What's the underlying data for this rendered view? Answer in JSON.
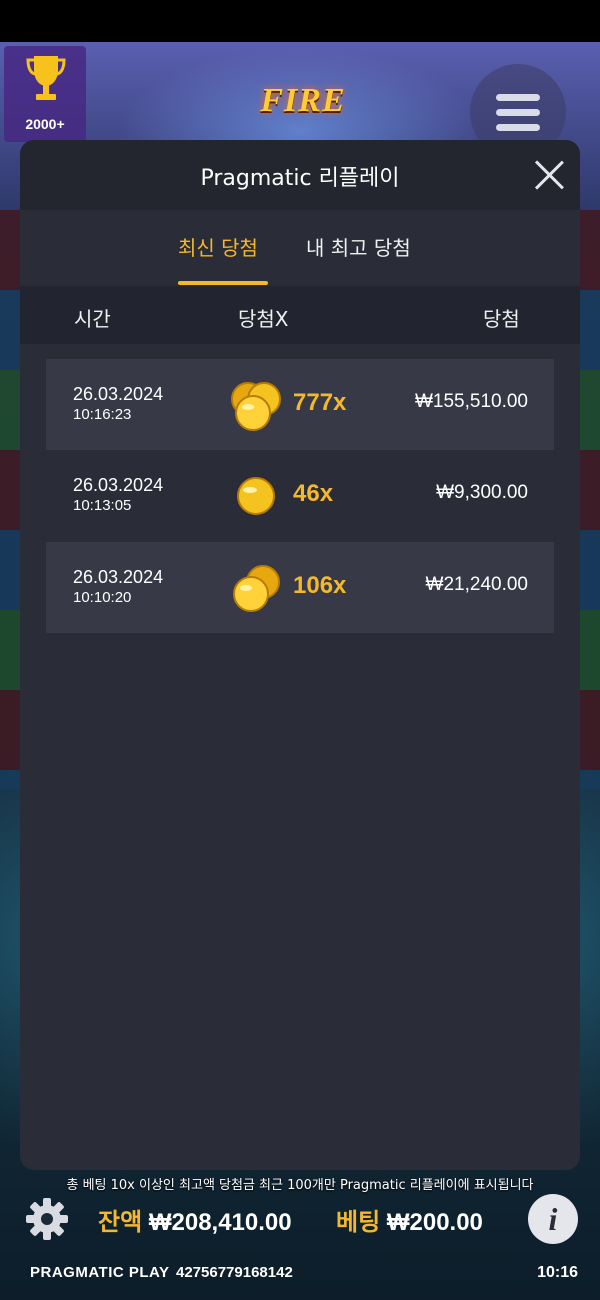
{
  "game": {
    "trophy_count": "2000+",
    "logo_text": "FIRE",
    "menu_icon": "hamburger-menu-icon"
  },
  "modal": {
    "title": "Pragmatic 리플레이",
    "tabs": [
      {
        "label": "최신 당첨",
        "active": true
      },
      {
        "label": "내 최고 당첨",
        "active": false
      }
    ],
    "columns": {
      "time": "시간",
      "multiplier": "당첨X",
      "win": "당첨"
    },
    "rows": [
      {
        "date": "26.03.2024",
        "time": "10:16:23",
        "multiplier": "777x",
        "win": "₩155,510.00",
        "coins": 3
      },
      {
        "date": "26.03.2024",
        "time": "10:13:05",
        "multiplier": "46x",
        "win": "₩9,300.00",
        "coins": 1
      },
      {
        "date": "26.03.2024",
        "time": "10:10:20",
        "multiplier": "106x",
        "win": "₩21,240.00",
        "coins": 2
      }
    ]
  },
  "footer": {
    "notice": "총 베팅 10x 이상인 최고액 당첨금 최근 100개만 Pragmatic 리플레이에 표시됩니다",
    "balance_label": "잔액",
    "balance_value": "₩208,410.00",
    "bet_label": "베팅",
    "bet_value": "₩200.00",
    "info_label": "i",
    "brand": "PRAGMATIC PLAY",
    "session_id": "42756779168142",
    "clock": "10:16"
  },
  "colors": {
    "accent": "#f5b82c",
    "modal_bg": "#2a2c38",
    "row_bg": "#373946"
  }
}
